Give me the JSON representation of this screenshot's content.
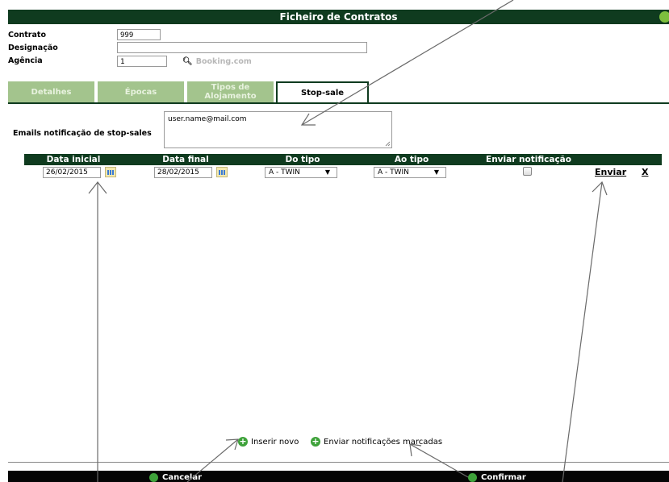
{
  "window": {
    "title": "Ficheiro de Contratos"
  },
  "form": {
    "contrato_label": "Contrato",
    "contrato_value": "999",
    "designacao_label": "Designação",
    "designacao_value": "",
    "agencia_label": "Agência",
    "agencia_value": "1",
    "agencia_search_placeholder": "Booking.com"
  },
  "tabs": [
    {
      "label": "Detalhes",
      "active": false
    },
    {
      "label": "Épocas",
      "active": false
    },
    {
      "label": "Tipos de Alojamento",
      "active": false
    },
    {
      "label": "Stop-sale",
      "active": true
    }
  ],
  "stopsale": {
    "emails_label": "Emails notificação de stop-sales",
    "emails_value": "user.name@mail.com",
    "columns": [
      "Data inicial",
      "Data final",
      "Do tipo",
      "Ao tipo",
      "Enviar notificação"
    ],
    "rows": [
      {
        "data_inicial": "26/02/2015",
        "data_final": "28/02/2015",
        "do_tipo": "A - TWIN",
        "ao_tipo": "A - TWIN",
        "enviar_notificacao": false,
        "send_label": "Enviar",
        "delete_label": "X"
      }
    ]
  },
  "actions": {
    "inserir_novo": "Inserir novo",
    "enviar_notificacoes": "Enviar notificações marcadas"
  },
  "footer": {
    "cancelar": "Cancelar",
    "confirmar": "Confirmar"
  },
  "colors": {
    "header_dark": "#0f3b1f",
    "tab_inactive": "#a3c48d",
    "add_icon": "#3ea23a"
  }
}
